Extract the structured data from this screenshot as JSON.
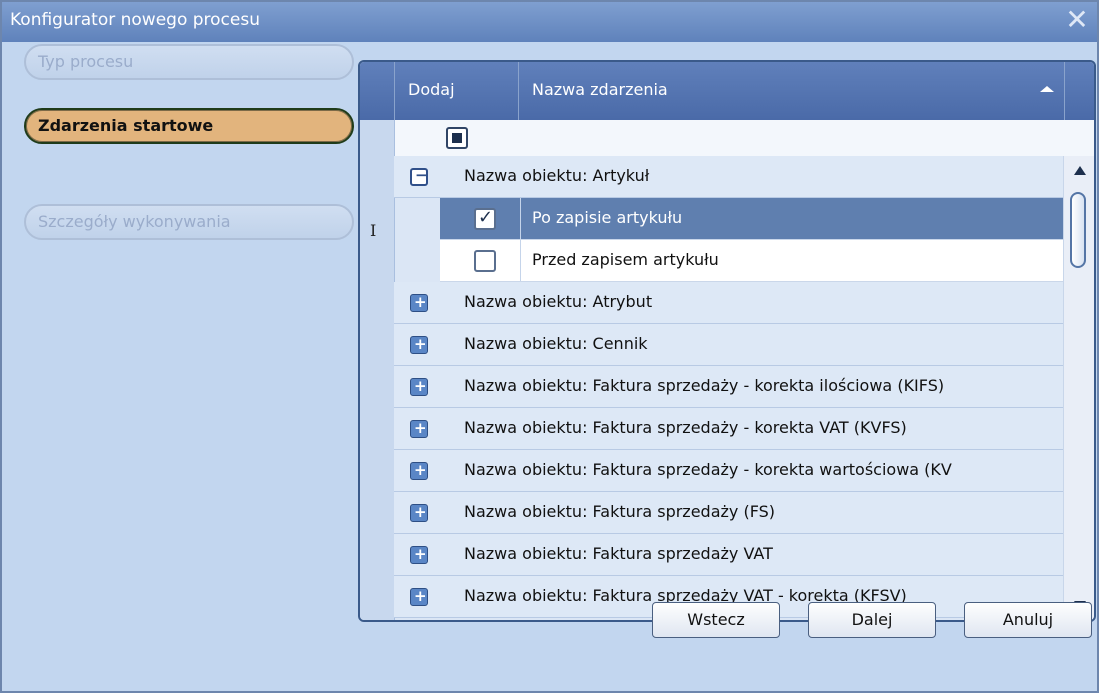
{
  "window": {
    "title": "Konfigurator nowego procesu",
    "close_glyph": "✕"
  },
  "steps": [
    {
      "label": "Typ procesu",
      "state": "disabled"
    },
    {
      "label": "Zdarzenia startowe",
      "state": "active"
    },
    {
      "label": "Szczegóły wykonywania",
      "state": "disabled"
    }
  ],
  "grid": {
    "columns": {
      "dodaj": "Dodaj",
      "nazwa": "Nazwa zdarzenia"
    },
    "cursor_glyph": "I",
    "groups": [
      {
        "label": "Nazwa obiektu: Artykuł",
        "expanded": true,
        "items": [
          {
            "label": "Po zapisie artykułu",
            "checked": true,
            "selected": true
          },
          {
            "label": "Przed zapisem artykułu",
            "checked": false,
            "selected": false
          }
        ]
      },
      {
        "label": "Nazwa obiektu: Atrybut",
        "expanded": false
      },
      {
        "label": "Nazwa obiektu: Cennik",
        "expanded": false
      },
      {
        "label": "Nazwa obiektu: Faktura sprzedaży - korekta ilościowa (KIFS)",
        "expanded": false
      },
      {
        "label": "Nazwa obiektu: Faktura sprzedaży - korekta VAT (KVFS)",
        "expanded": false
      },
      {
        "label": "Nazwa obiektu: Faktura sprzedaży - korekta wartościowa (KV",
        "expanded": false
      },
      {
        "label": "Nazwa obiektu: Faktura sprzedaży (FS)",
        "expanded": false
      },
      {
        "label": "Nazwa obiektu: Faktura sprzedaży VAT",
        "expanded": false
      },
      {
        "label": "Nazwa obiektu: Faktura sprzedaży VAT - korekta (KFSV)",
        "expanded": false
      }
    ]
  },
  "buttons": {
    "back": "Wstecz",
    "next": "Dalej",
    "cancel": "Anuluj"
  },
  "colors": {
    "title_bg": "#6a8cc5",
    "active_step": "#e2b47d",
    "selected_row": "#5f7faf",
    "header_bg": "#5474b0"
  }
}
